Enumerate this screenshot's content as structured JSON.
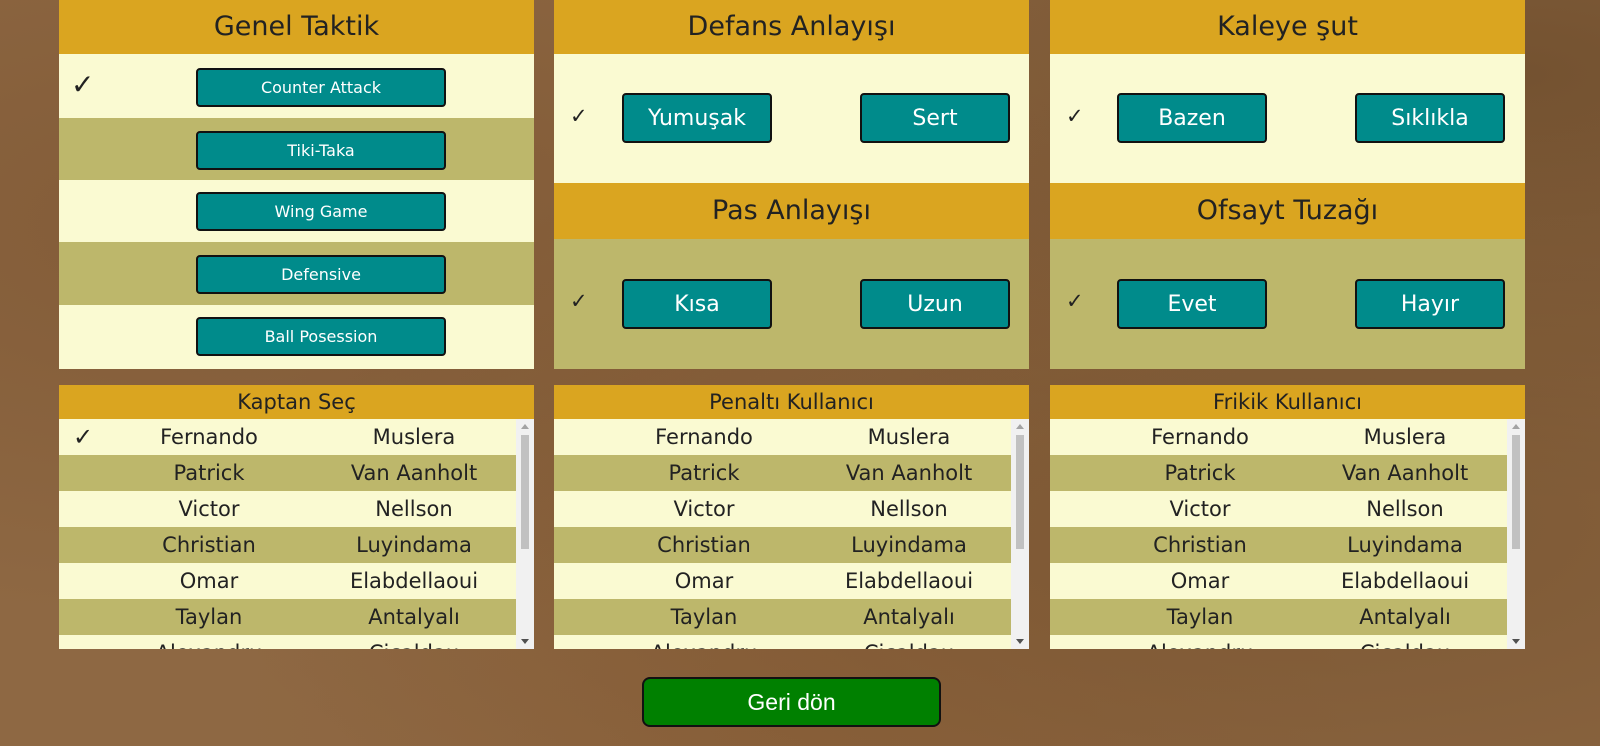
{
  "general_tactic": {
    "title": "Genel Taktik",
    "check": "✓",
    "options": [
      "Counter Attack",
      "Tiki-Taka",
      "Wing Game",
      "Defensive",
      "Ball Posession"
    ],
    "selected_index": 0
  },
  "defense": {
    "title": "Defans Anlayışı",
    "check": "✓",
    "options": [
      "Yumuşak",
      "Sert"
    ]
  },
  "shot": {
    "title": "Kaleye şut",
    "check": "✓",
    "options": [
      "Bazen",
      "Sıklıkla"
    ]
  },
  "pass": {
    "title": "Pas Anlayışı",
    "check": "✓",
    "options": [
      "Kısa",
      "Uzun"
    ]
  },
  "offside": {
    "title": "Ofsayt Tuzağı",
    "check": "✓",
    "options": [
      "Evet",
      "Hayır"
    ]
  },
  "captain": {
    "title": "Kaptan Seç",
    "check": "✓",
    "selected_index": 0
  },
  "penalty": {
    "title": "Penaltı Kullanıcı"
  },
  "freekick": {
    "title": "Frikik Kullanıcı"
  },
  "players": [
    {
      "first": "Fernando",
      "last": "Muslera"
    },
    {
      "first": "Patrick",
      "last": "Van Aanholt"
    },
    {
      "first": "Victor",
      "last": "Nellson"
    },
    {
      "first": "Christian",
      "last": "Luyindama"
    },
    {
      "first": "Omar",
      "last": "Elabdellaoui"
    },
    {
      "first": "Taylan",
      "last": "Antalyalı"
    },
    {
      "first": "Alexandru",
      "last": "Cicaldau"
    }
  ],
  "back_button": "Geri dön",
  "colors": {
    "header": "#daa520",
    "row_light": "#fafad2",
    "row_olive": "#bdb76b",
    "button": "#008b8b",
    "back_button": "#008000"
  }
}
